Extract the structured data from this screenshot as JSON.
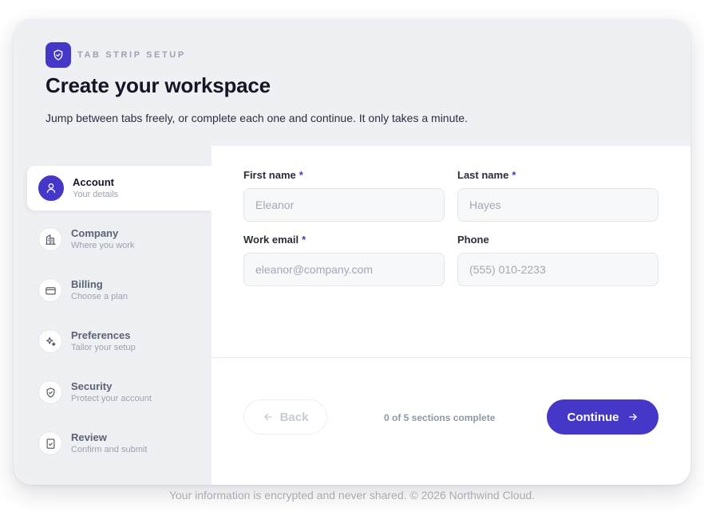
{
  "header": {
    "eyebrow": "TAB STRIP SETUP",
    "title": "Create your workspace",
    "subtitle": "Jump between tabs freely, or complete each one and continue. It only takes a minute."
  },
  "tabs": [
    {
      "label": "Account",
      "sub": "Your details",
      "icon": "user-icon",
      "active": true
    },
    {
      "label": "Company",
      "sub": "Where you work",
      "icon": "building-icon",
      "active": false
    },
    {
      "label": "Billing",
      "sub": "Choose a plan",
      "icon": "credit-card-icon",
      "active": false
    },
    {
      "label": "Preferences",
      "sub": "Tailor your setup",
      "icon": "sparkle-icon",
      "active": false
    },
    {
      "label": "Security",
      "sub": "Protect your account",
      "icon": "shield-icon",
      "active": false
    },
    {
      "label": "Review",
      "sub": "Confirm and submit",
      "icon": "checklist-icon",
      "active": false
    }
  ],
  "form": {
    "first_name": {
      "label": "First name",
      "required": "*",
      "placeholder": "Eleanor"
    },
    "last_name": {
      "label": "Last name",
      "required": "*",
      "placeholder": "Hayes"
    },
    "work_email": {
      "label": "Work email",
      "required": "*",
      "placeholder": "eleanor@company.com"
    },
    "phone": {
      "label": "Phone",
      "placeholder": "(555) 010-2233"
    }
  },
  "actions": {
    "back_label": "Back",
    "progress_text": "0 of 5 sections complete",
    "continue_label": "Continue"
  },
  "footer": "Your information is encrypted and never shared. © 2026 Northwind Cloud.",
  "colors": {
    "accent": "#4537c7",
    "card_bg": "#eef0f4",
    "panel_bg": "#ffffff"
  }
}
